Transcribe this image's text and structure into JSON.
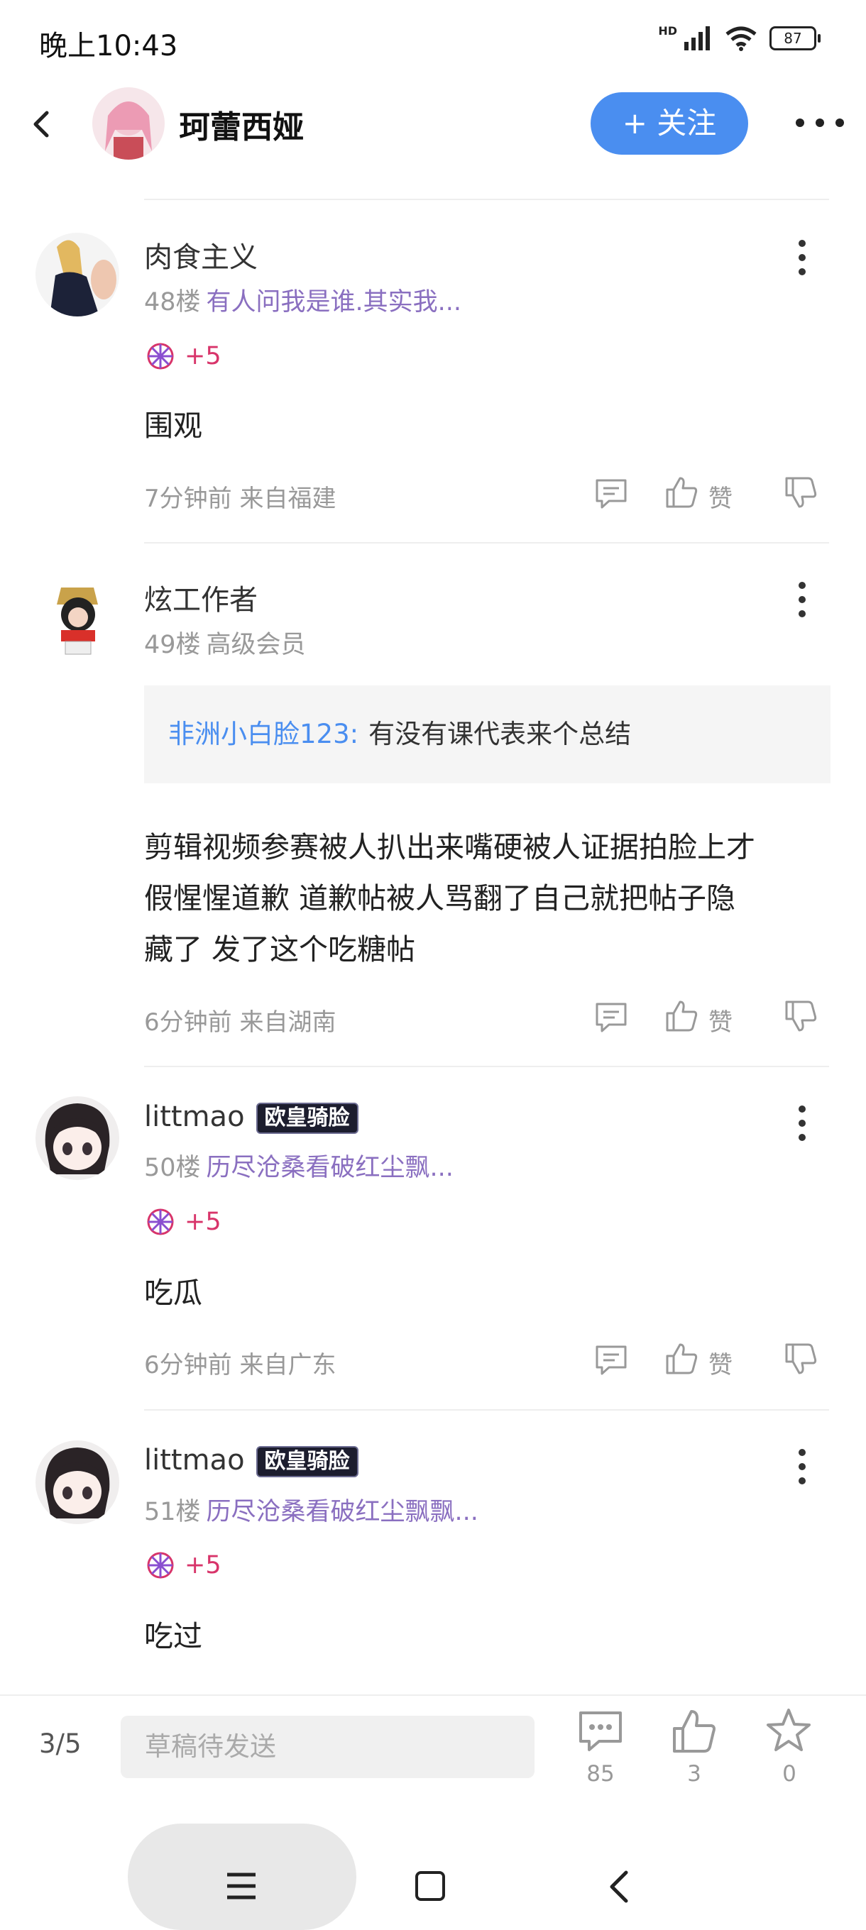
{
  "status_bar": {
    "time": "晚上10:43",
    "hd": "HD",
    "battery": "87"
  },
  "header": {
    "name": "珂蕾西娅",
    "follow_label": "+ 关注"
  },
  "posts": [
    {
      "author": "肉食主义",
      "floor": "48楼",
      "title": "有人问我是谁.其实我...",
      "reward": "+5",
      "content": "围观",
      "time": "7分钟前 来自福建",
      "like_label": "赞"
    },
    {
      "author": "炫工作者",
      "floor": "49楼",
      "title": "高级会员",
      "quote_user": "非洲小白脸123:",
      "quote_text": "有没有课代表来个总结",
      "content_lines": [
        "剪辑视频参赛被人扒出来嘴硬被人证据拍脸上才",
        "假惺惺道歉 道歉帖被人骂翻了自己就把帖子隐",
        "藏了 发了这个吃糖帖"
      ],
      "time": "6分钟前 来自湖南",
      "like_label": "赞"
    },
    {
      "author": "littmao",
      "badge": "欧皇骑脸",
      "floor": "50楼",
      "title": "历尽沧桑看破红尘飘...",
      "reward": "+5",
      "content": "吃瓜",
      "time": "6分钟前 来自广东",
      "like_label": "赞"
    },
    {
      "author": "littmao",
      "badge": "欧皇骑脸",
      "floor": "51楼",
      "title": "历尽沧桑看破红尘飘飘...",
      "reward": "+5",
      "content": "吃过"
    }
  ],
  "bottom_bar": {
    "page": "3/5",
    "draft_placeholder": "草稿待发送",
    "comments": "85",
    "likes": "3",
    "favorites": "0"
  },
  "colors": {
    "accent": "#4a8ef0",
    "title_purple": "#8a6fc0",
    "reward_pink": "#d8346a"
  }
}
